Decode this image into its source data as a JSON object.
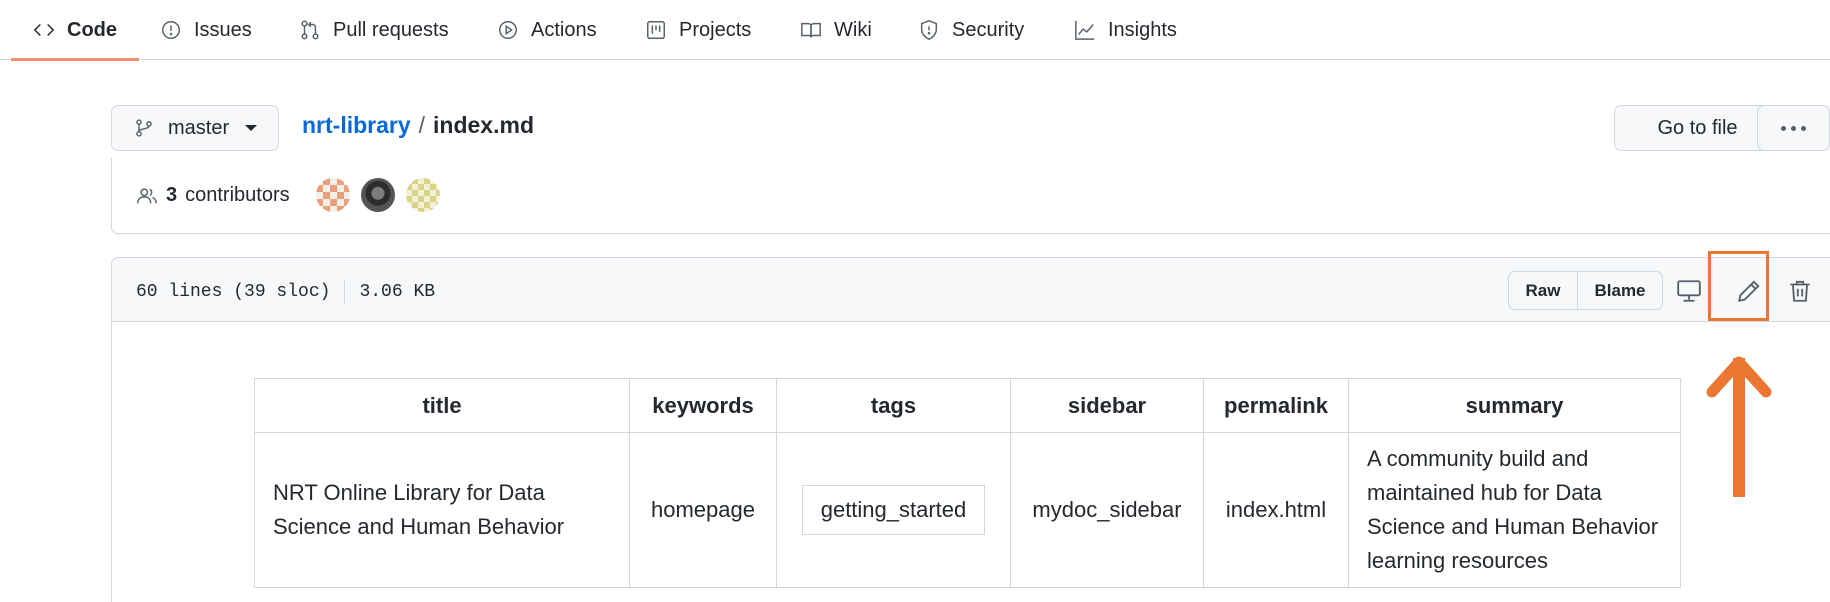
{
  "nav": {
    "tabs": [
      {
        "label": "Code",
        "icon": "code-icon",
        "selected": true
      },
      {
        "label": "Issues",
        "icon": "issue-icon"
      },
      {
        "label": "Pull requests",
        "icon": "pull-request-icon"
      },
      {
        "label": "Actions",
        "icon": "play-icon"
      },
      {
        "label": "Projects",
        "icon": "project-icon"
      },
      {
        "label": "Wiki",
        "icon": "book-icon"
      },
      {
        "label": "Security",
        "icon": "shield-icon"
      },
      {
        "label": "Insights",
        "icon": "graph-icon"
      }
    ]
  },
  "branch": {
    "name": "master"
  },
  "breadcrumb": {
    "repo": "nrt-library",
    "separator": "/",
    "file": "index.md"
  },
  "actions": {
    "goto_file": "Go to file"
  },
  "contributors": {
    "count": "3",
    "label": "contributors"
  },
  "file": {
    "lines": "60 lines (39 sloc)",
    "size": "3.06 KB",
    "raw_label": "Raw",
    "blame_label": "Blame"
  },
  "table": {
    "headers": [
      "title",
      "keywords",
      "tags",
      "sidebar",
      "permalink",
      "summary"
    ],
    "row": {
      "title": "NRT Online Library for Data Science and Human Behavior",
      "keywords": "homepage",
      "tags": "getting_started",
      "sidebar": "mydoc_sidebar",
      "permalink": "index.html",
      "summary": "A community build and maintained hub for Data Science and Human Behavior learning resources"
    }
  },
  "colors": {
    "accent_orange": "#ea7631",
    "link_blue": "#0969da",
    "tab_underline": "#fd8c73"
  }
}
